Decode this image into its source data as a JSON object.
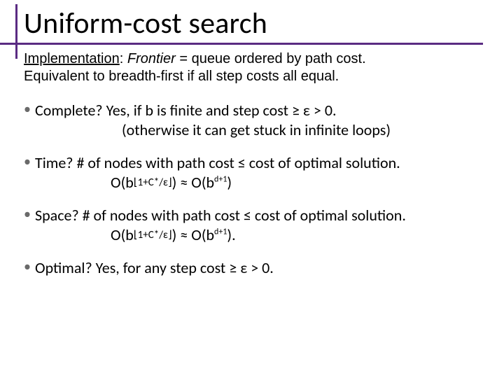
{
  "title": "Uniform-cost search",
  "intro": {
    "label": "Implementation",
    "frontier_word": "Frontier",
    "rest1": " = queue ordered by path cost.",
    "line2": "Equivalent to breadth-first if all step costs all equal."
  },
  "items": {
    "complete": {
      "q": "Complete?",
      "ans1": " Yes, if b is finite and step cost ≥ ε > 0.",
      "ans2": "(otherwise it can get stuck in infinite loops)"
    },
    "time": {
      "q": "Time?",
      "ans1": "  # of nodes with path cost ≤ cost of optimal solution.",
      "formula_a": "O(b",
      "exp1": "⌊1+C*/ε⌋",
      "formula_b": ") ≈ O(b",
      "exp2": "d+1",
      "formula_c": ")"
    },
    "space": {
      "q": "Space?",
      "ans1": " # of nodes with path cost ≤ cost of optimal solution.",
      "formula_a": "O(b",
      "exp1": "⌊1+C*/ε⌋",
      "formula_b": ") ≈ O(b",
      "exp2": "d+1",
      "formula_c": ")."
    },
    "optimal": {
      "q": "Optimal?",
      "ans": "  Yes, for any step cost ≥ ε > 0."
    }
  }
}
